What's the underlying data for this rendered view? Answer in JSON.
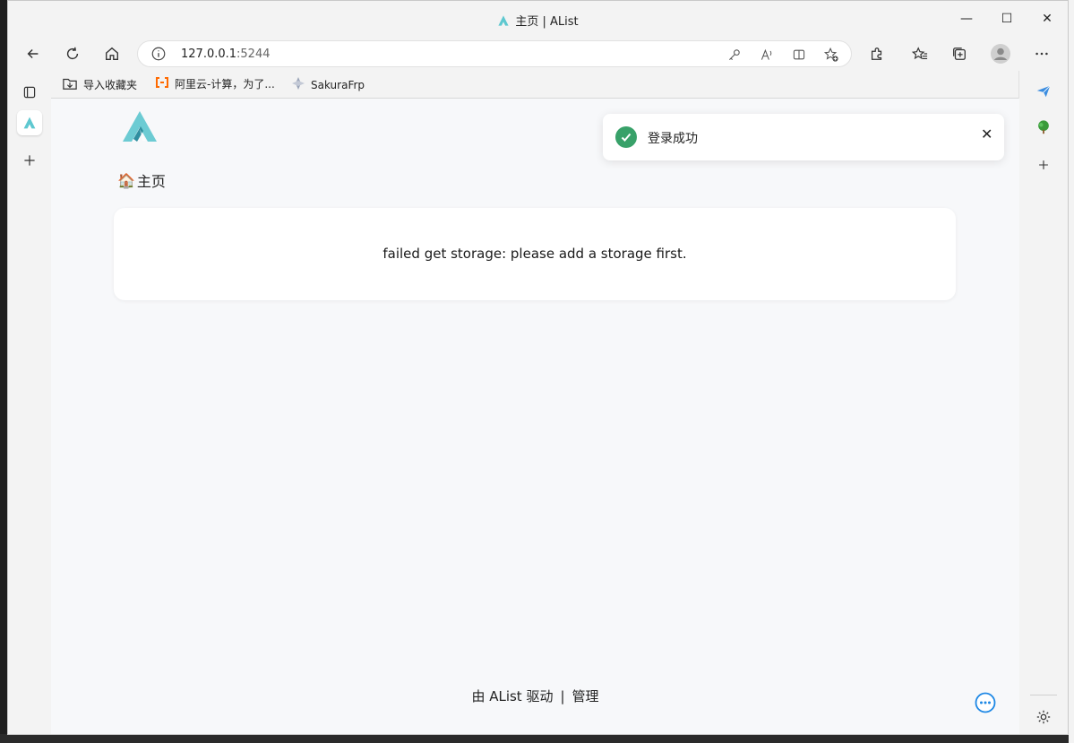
{
  "window": {
    "title": "主页 | AList",
    "minimize": "—",
    "maximize": "☐",
    "close": "✕"
  },
  "address_bar": {
    "host": "127.0.0.1",
    "port": ":5244"
  },
  "favorites": [
    {
      "label": "导入收藏夹",
      "icon": "import-favorites-icon"
    },
    {
      "label": "阿里云-计算，为了...",
      "icon": "aliyun-icon"
    },
    {
      "label": "SakuraFrp",
      "icon": "sakurafrp-icon"
    }
  ],
  "main": {
    "breadcrumb_emoji": "🏠",
    "breadcrumb": "主页",
    "error_message": "failed get storage: please add a storage first.",
    "footer_powered": "由 AList 驱动",
    "footer_separator": "|",
    "footer_manage": "管理"
  },
  "toast": {
    "message": "登录成功",
    "close": "✕"
  },
  "colors": {
    "brand": "#5ec8d0",
    "success": "#38a169",
    "link": "#1e88e5"
  }
}
